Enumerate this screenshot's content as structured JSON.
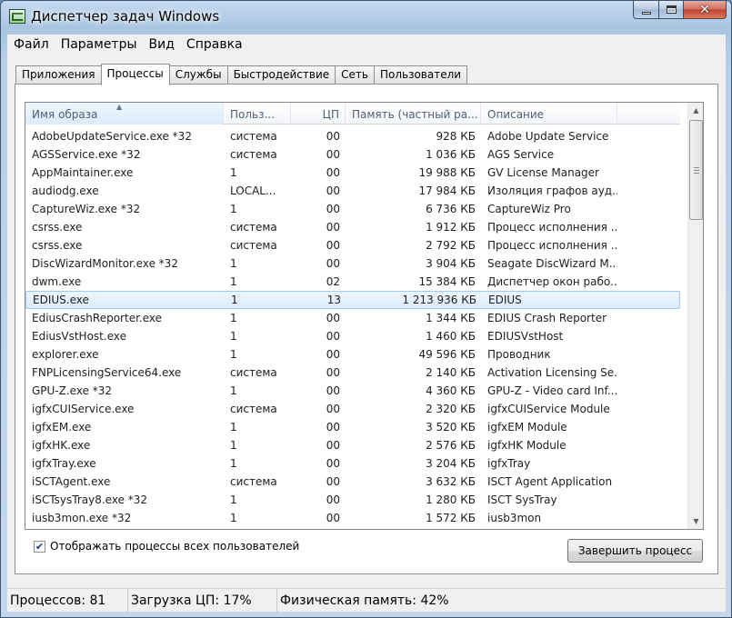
{
  "window": {
    "title": "Диспетчер задач Windows"
  },
  "menu": [
    "Файл",
    "Параметры",
    "Вид",
    "Справка"
  ],
  "tabs": [
    "Приложения",
    "Процессы",
    "Службы",
    "Быстродействие",
    "Сеть",
    "Пользователи"
  ],
  "active_tab": "Процессы",
  "columns": [
    "Имя образа",
    "Польз...",
    "ЦП",
    "Память (частный ра...",
    "Описание"
  ],
  "rows": [
    [
      "AdobeUpdateService.exe *32",
      "система",
      "00",
      "928 КБ",
      "Adobe Update Service"
    ],
    [
      "AGSService.exe *32",
      "система",
      "00",
      "1 036 КБ",
      "AGS Service"
    ],
    [
      "AppMaintainer.exe",
      "1",
      "00",
      "19 988 КБ",
      "GV License Manager"
    ],
    [
      "audiodg.exe",
      "LOCAL...",
      "00",
      "17 984 КБ",
      "Изоляция графов ауд..."
    ],
    [
      "CaptureWiz.exe *32",
      "1",
      "00",
      "6 736 КБ",
      "CaptureWiz Pro"
    ],
    [
      "csrss.exe",
      "система",
      "00",
      "1 912 КБ",
      "Процесс исполнения ..."
    ],
    [
      "csrss.exe",
      "система",
      "00",
      "2 792 КБ",
      "Процесс исполнения ..."
    ],
    [
      "DiscWizardMonitor.exe *32",
      "1",
      "00",
      "3 904 КБ",
      "Seagate DiscWizard M..."
    ],
    [
      "dwm.exe",
      "1",
      "02",
      "15 384 КБ",
      "Диспетчер окон рабо..."
    ],
    [
      "EDIUS.exe",
      "1",
      "13",
      "1 213 936 КБ",
      "EDIUS"
    ],
    [
      "EdiusCrashReporter.exe",
      "1",
      "00",
      "1 344 КБ",
      "EDIUS Crash Reporter"
    ],
    [
      "EdiusVstHost.exe",
      "1",
      "00",
      "1 460 КБ",
      "EDIUSVstHost"
    ],
    [
      "explorer.exe",
      "1",
      "00",
      "49 596 КБ",
      "Проводник"
    ],
    [
      "FNPLicensingService64.exe",
      "система",
      "00",
      "2 140 КБ",
      "Activation Licensing Se..."
    ],
    [
      "GPU-Z.exe *32",
      "1",
      "00",
      "4 360 КБ",
      "GPU-Z - Video card Inf..."
    ],
    [
      "igfxCUIService.exe",
      "система",
      "00",
      "2 320 КБ",
      "igfxCUIService Module"
    ],
    [
      "igfxEM.exe",
      "1",
      "00",
      "3 520 КБ",
      "igfxEM Module"
    ],
    [
      "igfxHK.exe",
      "1",
      "00",
      "2 576 КБ",
      "igfxHK Module"
    ],
    [
      "igfxTray.exe",
      "1",
      "00",
      "3 204 КБ",
      "igfxTray"
    ],
    [
      "iSCTAgent.exe",
      "система",
      "00",
      "3 632 КБ",
      "ISCT Agent Application"
    ],
    [
      "iSCTsysTray8.exe *32",
      "1",
      "00",
      "1 280 КБ",
      "ISCT SysTray"
    ],
    [
      "iusb3mon.exe *32",
      "1",
      "00",
      "1 572 КБ",
      "iusb3mon"
    ]
  ],
  "selected_row": "EDIUS.exe",
  "show_all_users": {
    "label": "Отображать процессы всех пользователей",
    "checked": true
  },
  "end_process_button": "Завершить процесс",
  "status": {
    "processes": "Процессов: 81",
    "cpu": "Загрузка ЦП: 17%",
    "memory": "Физическая память: 42%"
  }
}
